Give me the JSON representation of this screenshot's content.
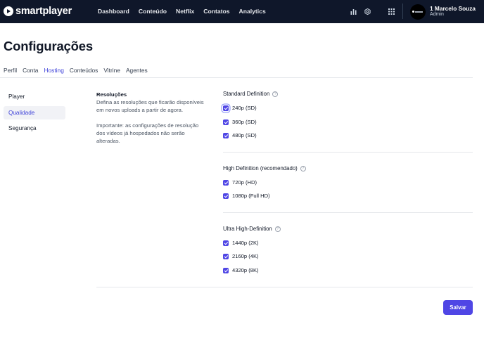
{
  "brand": {
    "name": "smartplayer",
    "icon": "play-circle-icon"
  },
  "nav": {
    "items": [
      "Dashboard",
      "Conteúdo",
      "Netflix",
      "Contatos",
      "Analytics"
    ]
  },
  "toolbar": {
    "icons": [
      "bar-chart-icon",
      "gear-icon",
      "apps-grid-icon"
    ]
  },
  "user": {
    "name": "1 Marcelo Souza",
    "role": "Admin"
  },
  "page": {
    "title": "Configurações",
    "tabs": [
      "Perfil",
      "Conta",
      "Hosting",
      "Conteúdos",
      "Vitrine",
      "Agentes"
    ],
    "active_tab": "Hosting"
  },
  "sidebar": {
    "items": [
      "Player",
      "Qualidade",
      "Segurança"
    ],
    "active": "Qualidade"
  },
  "description": {
    "title": "Resoluções",
    "text": "Defina as resoluções que ficarão disponíveis em novos uploads a partir de agora.",
    "note": "Importante: as configurações de resolução dos vídeos já hospedados não serão alteradas."
  },
  "groups": [
    {
      "title": "Standard Definition",
      "options": [
        {
          "label": "240p (SD)",
          "checked": true
        },
        {
          "label": "360p (SD)",
          "checked": true
        },
        {
          "label": "480p (SD)",
          "checked": true
        }
      ]
    },
    {
      "title": "High Definition (recomendado)",
      "options": [
        {
          "label": "720p (HD)",
          "checked": true
        },
        {
          "label": "1080p (Full HD)",
          "checked": true
        }
      ]
    },
    {
      "title": "Ultra High-Definition",
      "options": [
        {
          "label": "1440p (2K)",
          "checked": true
        },
        {
          "label": "2160p (4K)",
          "checked": true
        },
        {
          "label": "4320p (8K)",
          "checked": true
        }
      ]
    }
  ],
  "help_glyph": "?",
  "actions": {
    "save_label": "Salvar"
  },
  "colors": {
    "accent": "#4f46e5",
    "topbar": "#0f172a",
    "active_text": "#3b3fd8"
  }
}
